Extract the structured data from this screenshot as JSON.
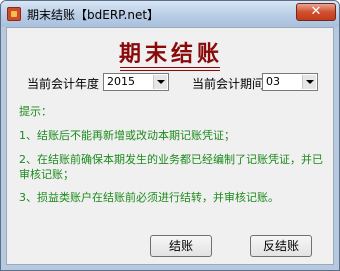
{
  "window": {
    "title": "期末结账【bdERP.net】",
    "close_label": "✕"
  },
  "heading": "期末结账",
  "year": {
    "label": "当前会计年度",
    "value": "2015"
  },
  "period": {
    "label": "当前会计期间",
    "value": "03"
  },
  "tips": {
    "title": "提示：",
    "items": [
      "1、结账后不能再新增或改动本期记账凭证；",
      "2、在结账前确保本期发生的业务都已经编制了记账凭证，并已审核记账；",
      "3、损益类账户在结账前必须进行结转，并审核记账。"
    ]
  },
  "buttons": {
    "settle": "结账",
    "unsettle": "反结账"
  },
  "colors": {
    "heading": "#8a0a0a",
    "tip_text": "#1d8a1d",
    "close_button": "#c03b1c"
  }
}
